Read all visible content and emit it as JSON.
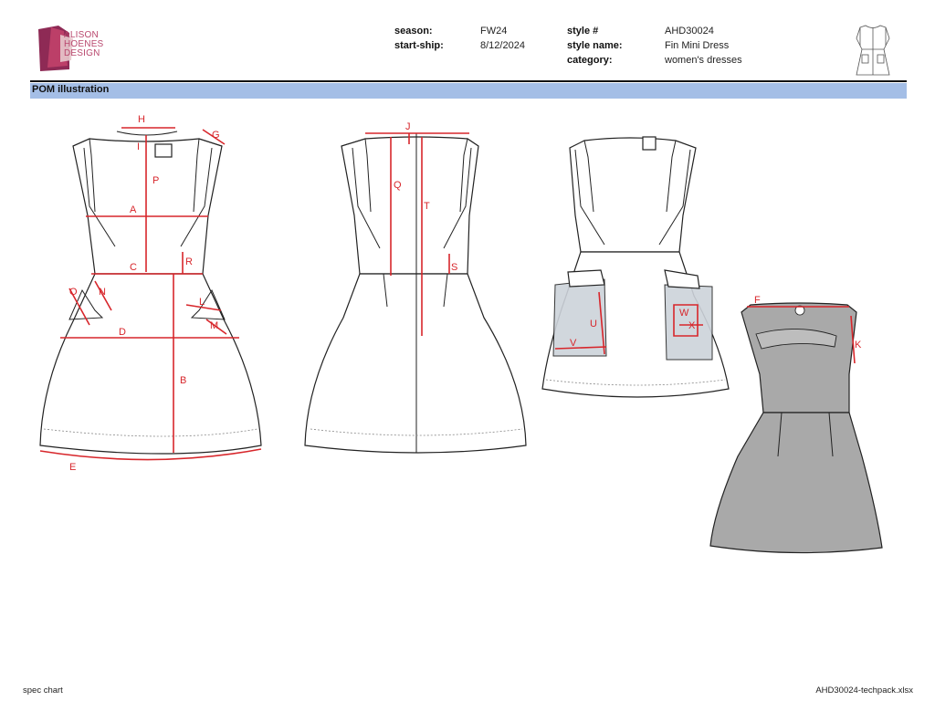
{
  "header": {
    "logo_text": "ALISON HOENES DESIGN",
    "logo_lines": [
      "ALISON",
      "HOENES",
      "DESIGN"
    ],
    "season_label": "season:",
    "season_value": "FW24",
    "start_ship_label": "start-ship:",
    "start_ship_value": "8/12/2024",
    "style_num_label": "style #",
    "style_num_value": "AHD30024",
    "style_name_label": "style name:",
    "style_name_value": "Fin Mini Dress",
    "category_label": "category:",
    "category_value": "women's dresses"
  },
  "section": {
    "title": "POM illustration"
  },
  "pom_letters": [
    "A",
    "B",
    "C",
    "D",
    "E",
    "F",
    "G",
    "H",
    "I",
    "J",
    "K",
    "L",
    "M",
    "N",
    "O",
    "P",
    "Q",
    "R",
    "S",
    "T",
    "U",
    "V",
    "W",
    "X"
  ],
  "footer": {
    "left": "spec chart",
    "right": "AHD30024-techpack.xlsx"
  },
  "colors": {
    "measure": "#d7262b",
    "section_bar": "#a4bee6",
    "lining": "#a9a9a9",
    "logo": "#b9486e"
  }
}
